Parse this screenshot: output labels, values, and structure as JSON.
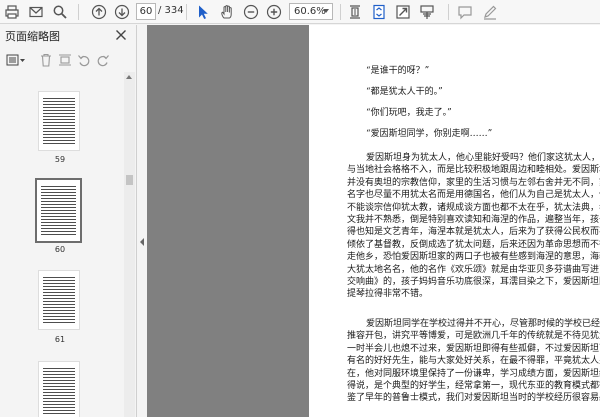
{
  "toolbar": {
    "page_current": "60",
    "page_total": "/ 334",
    "zoom": "60.6%",
    "icons": [
      "print-icon",
      "email-icon",
      "search-icon",
      "page-up-icon",
      "page-down-icon",
      "select-tool-icon",
      "hand-tool-icon",
      "zoom-out-icon",
      "zoom-in-icon",
      "fit-page-icon",
      "scroll-mode-icon",
      "full-screen-icon",
      "read-mode-icon",
      "comment-icon",
      "draw-icon"
    ]
  },
  "panel": {
    "title": "页面缩略图",
    "thumbnails": [
      {
        "label": "59",
        "selected": false
      },
      {
        "label": "60",
        "selected": true
      },
      {
        "label": "61",
        "selected": false
      }
    ]
  },
  "document": {
    "paragraphs": [
      "“是谁干的呀？”",
      "“都是犹太人干的。”",
      "“你们玩吧，我走了。”",
      "“爱因斯坦同学，你别走啊……”",
      "爱因斯坦身为犹太人，他心里能好受吗？他们家这犹太人，并",
      "与当地社会格格不入，而是比较积极地跟周边和睦相处。爱因斯坦家",
      "并没有奥坦的宗教信仰，家里的生活习惯与左邻右舍并无不同，家族",
      "名字也尽量不用犹太名而是用德国名，他们从为自己是犹太人，但是",
      "不能谈宗信仰犹太教，诸规成谈方面也都不太在乎，犹太法典，老自",
      "文我并不熟悉，倒是特别喜欢读知和海涅的作品，遍整当年，孩子的",
      "得也知是文艺青年，海涅本就是犹太人，后来为了获得公民权而不得",
      "倾依了基督教，反倒成选了犹太问题，后来还因为革命思想而不得不",
      "走他乡，恐怕爱因斯坦家的两口子也被有些感到海涅的意思，海勒便",
      "大犹太地名名，他的名作《欢乐颂》就是由华亚贝多芬谱曲写进了《第",
      "交响曲》的，孩子妈妈音乐功底很深，耳濡目染之下，爱因斯坦同学",
      "提琴拉得非常不错。",
      "爱因斯坦同学在学校过得并不开心，尽管那时候的学校已经在提",
      "推容开包，讲究平等博爱，可是欧洲几千年的传统就是不待见犹太人",
      "一时半会儿也熄不过来，爱因斯坦即得有些孤僻，不过爱因斯坦可是",
      "有名的好好先生，能与大家处好关系，在最不得罪，平竟犹太人身份",
      "在，他对同服环境里保持了一份谦卑，学习成绩方面，爱因斯坦给绝对",
      "得说，是个典型的好学生，经常拿第一，现代东亚的教育模式都得和",
      "鉴了早年的普鲁士模式，我们对爱因斯坦当时的学校经历很容易感同"
    ]
  }
}
